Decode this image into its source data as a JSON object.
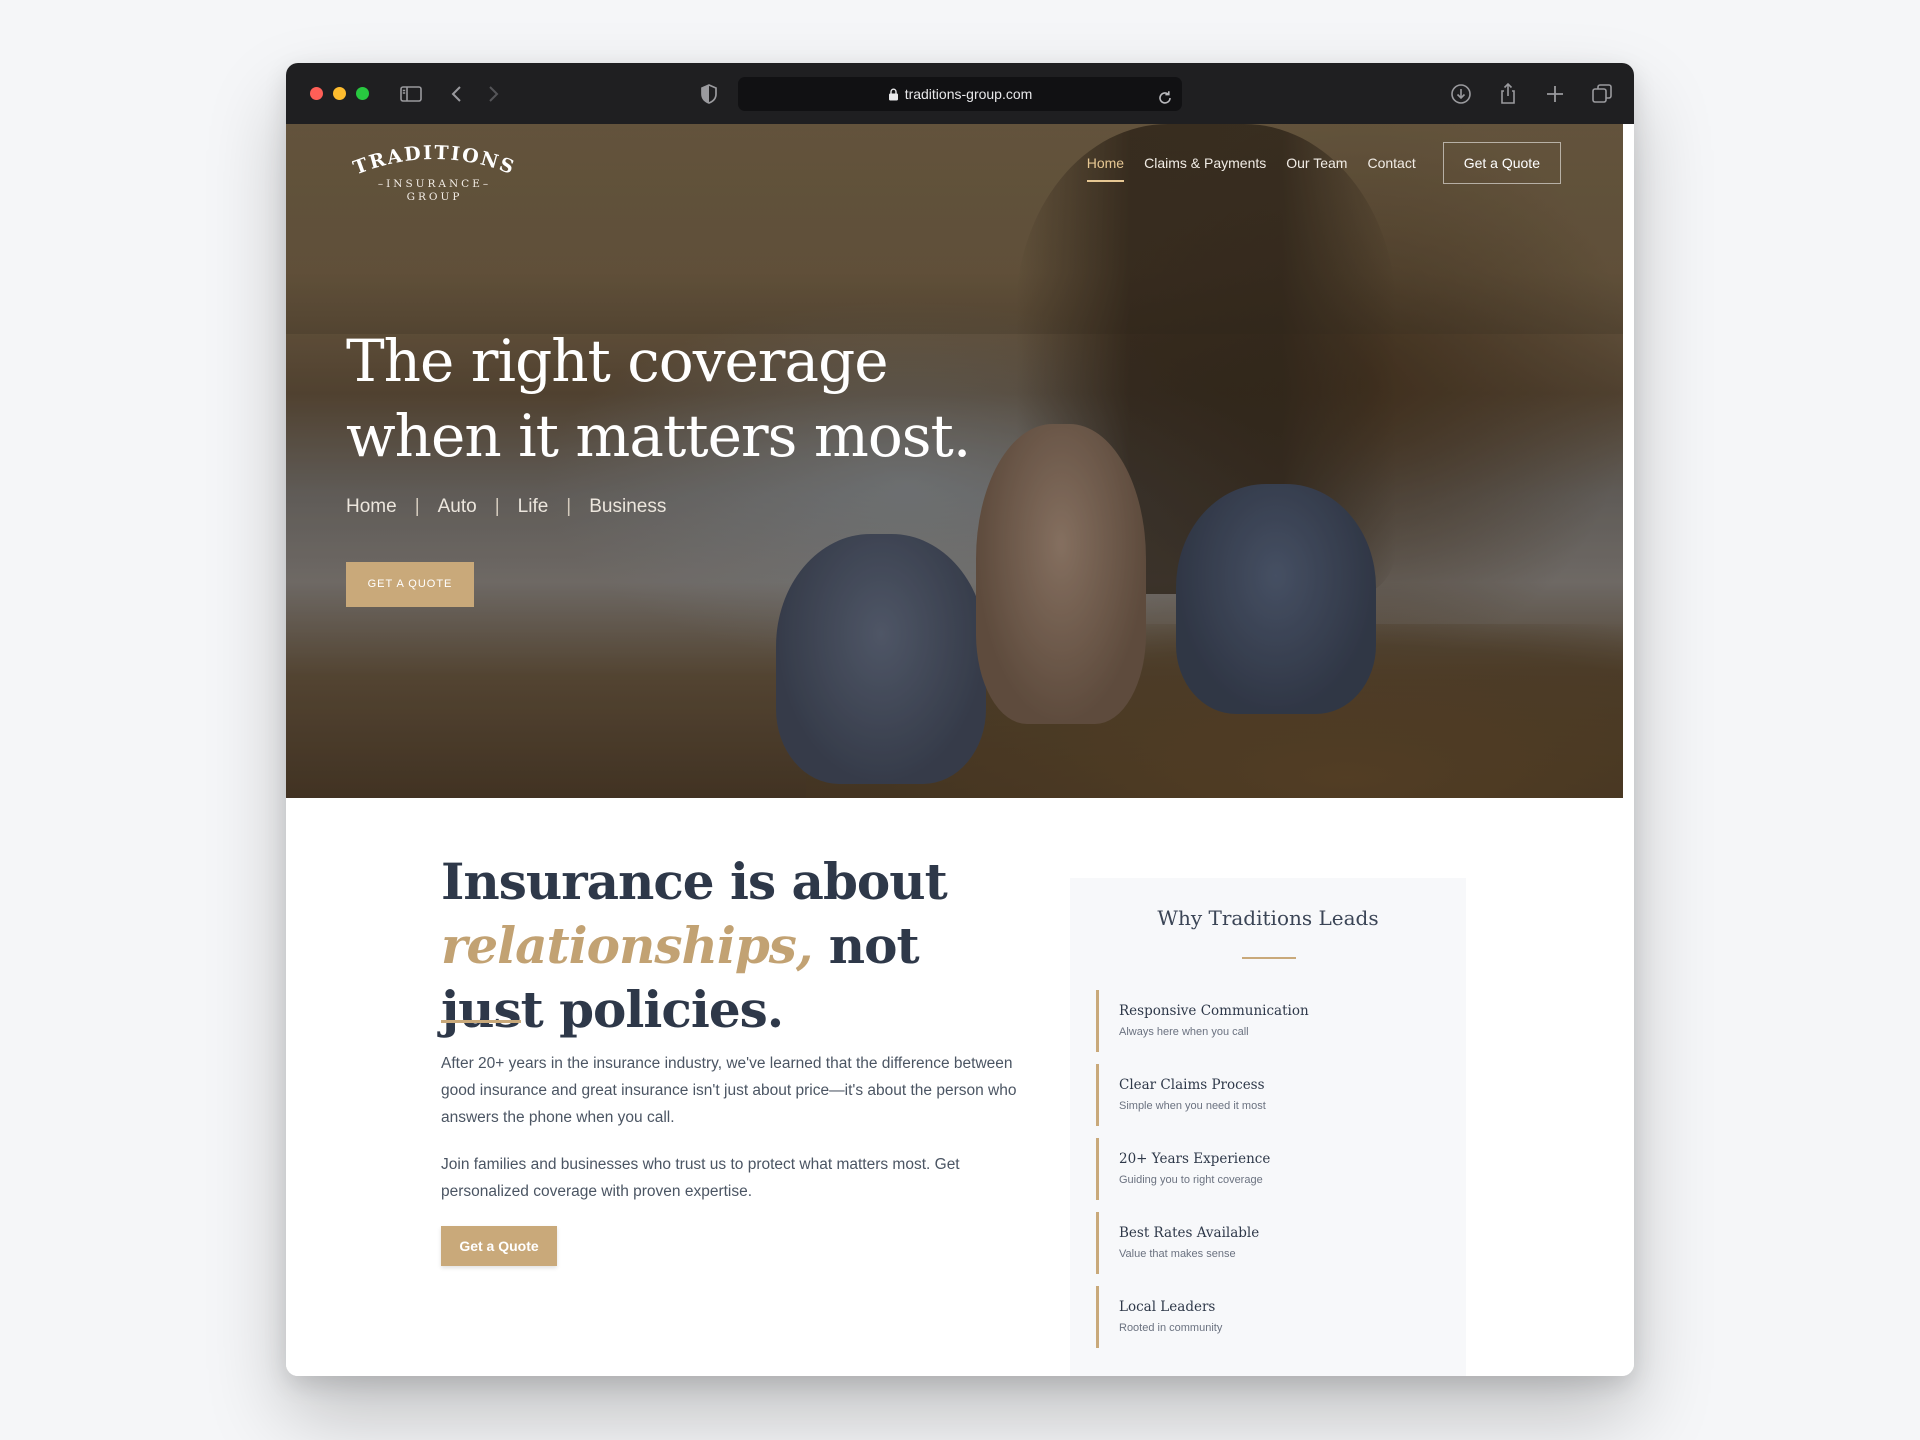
{
  "browser": {
    "url": "traditions-group.com",
    "colors": {
      "chrome": "#1f1f21",
      "address_bar": "#111113"
    }
  },
  "site": {
    "logo": {
      "word": "TRADITIONS",
      "line2": "–INSURANCE–",
      "line3": "GROUP"
    },
    "nav": {
      "items": [
        {
          "label": "Home",
          "active": true
        },
        {
          "label": "Claims & Payments",
          "active": false
        },
        {
          "label": "Our Team",
          "active": false
        },
        {
          "label": "Contact",
          "active": false
        }
      ],
      "cta": "Get a Quote"
    },
    "hero": {
      "title_line1": "The right coverage",
      "title_line2": "when it matters most.",
      "categories": [
        "Home",
        "Auto",
        "Life",
        "Business"
      ],
      "separator": "|",
      "cta": "GET A QUOTE"
    },
    "about": {
      "headline_part1": "Insurance is about",
      "headline_accent": "relationships,",
      "headline_part2": " not just policies.",
      "paragraph1": "After 20+ years in the insurance industry, we've learned that the difference between good insurance and great insurance isn't just about price—it's about the person who answers the phone when you call.",
      "paragraph2": "Join families and businesses who trust us to protect what matters most. Get personalized coverage with proven expertise.",
      "cta": "Get a Quote"
    },
    "why": {
      "title": "Why Traditions Leads",
      "items": [
        {
          "title": "Responsive Communication",
          "subtitle": "Always here when you call"
        },
        {
          "title": "Clear Claims Process",
          "subtitle": "Simple when you need it most"
        },
        {
          "title": "20+ Years Experience",
          "subtitle": "Guiding you to right coverage"
        },
        {
          "title": "Best Rates Available",
          "subtitle": "Value that makes sense"
        },
        {
          "title": "Local Leaders",
          "subtitle": "Rooted in community"
        }
      ]
    },
    "colors": {
      "gold": "#c9a97a",
      "navy_text": "#2e3849",
      "nav_active": "#e6c793"
    }
  },
  "icons": {
    "sidebar": "sidebar-icon",
    "back": "chevron-left-icon",
    "forward": "chevron-right-icon",
    "shield": "shield-icon",
    "lock": "lock-icon",
    "reload": "reload-icon",
    "download": "download-icon",
    "share": "share-icon",
    "new_tab": "plus-icon",
    "tabs": "tabs-overview-icon"
  }
}
